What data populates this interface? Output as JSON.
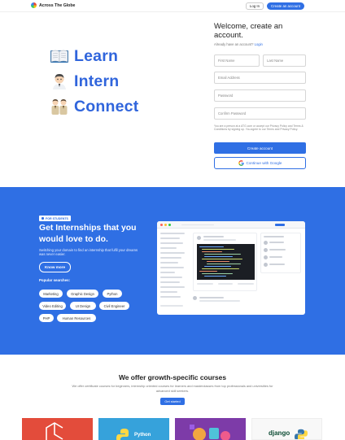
{
  "header": {
    "brand": "Across The Globe",
    "login_label": "Log In",
    "create_label": "Create an account"
  },
  "hero": {
    "items": [
      {
        "icon": "book-icon",
        "label": "Learn"
      },
      {
        "icon": "student-icon",
        "label": "Intern"
      },
      {
        "icon": "people-icon",
        "label": "Connect"
      }
    ]
  },
  "signup": {
    "title": "Welcome, create an account.",
    "already": "Already have an account?",
    "login_link": "Login",
    "first_name_placeholder": "First Name",
    "last_name_placeholder": "Last Name",
    "email_placeholder": "Email Address",
    "password_placeholder": "Password",
    "confirm_placeholder": "Confirm Password",
    "terms": "You are a person at a ATG.com or accept our Privacy Policy and Terms & Conditions by signing up. You agree to our Terms and Privacy Policy.",
    "create_button": "Create account",
    "google_button": "Continue with Google"
  },
  "internships": {
    "badge": "FOR STUDENTS",
    "title": "Get Internships that you would love to do.",
    "description": "Switching your domain to find an internship that fulfil your dreams was never easier.",
    "know_more": "Know more",
    "popular_label": "Popular searches:",
    "chips": [
      "Marketing",
      "Graphic Design",
      "Python",
      "Video Editing",
      "UI Design",
      "Civil Engineer",
      "PHP",
      "Human Resources"
    ]
  },
  "courses": {
    "title": "We offer growth-specific courses",
    "description": "We offer certificate courses for beginners, internship oriented courses for learners and masterclasses from top professionals and universities for advanced skill seekers.",
    "get_started": "Get started",
    "cards": [
      {
        "label": "",
        "color": "#e34c3b"
      },
      {
        "label": "Python",
        "color": "#36a2db"
      },
      {
        "label": "",
        "color": "#7d3ba8"
      },
      {
        "label": "django",
        "color": "#f8f8f8"
      }
    ]
  },
  "colors": {
    "accent": "#2f6fe4",
    "hero_text": "#3065dc"
  }
}
